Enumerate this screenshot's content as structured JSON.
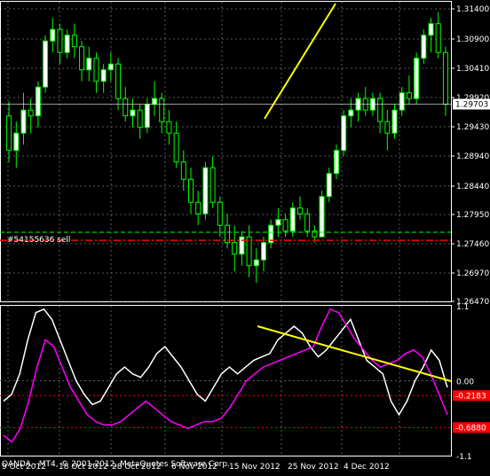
{
  "platform": {
    "copyright": "OANDA - MT4, © 2001-2012, MetaQuotes Software Corp."
  },
  "colors": {
    "background": "#000000",
    "grid": "#5a5a5a",
    "frame": "#ffffff",
    "candle_up": "#ffffff",
    "candle_down": "#00ff00",
    "trendline": "#ffff00",
    "order_line": "#00ff00",
    "stop_line": "#ff0000",
    "osc_main": "#ff00ff",
    "osc_signal": "#ffffff",
    "level_line": "#ff0000"
  },
  "order": {
    "label": "#54155636 sell"
  },
  "price_panel": {
    "current_price_label": "1.29703",
    "ticks": [
      "1.31400",
      "1.30900",
      "1.30410",
      "1.29920",
      "1.29430",
      "1.28940",
      "1.28440",
      "1.27950",
      "1.27460",
      "1.26970",
      "1.26470"
    ]
  },
  "osc_panel": {
    "ticks": [
      "1.1",
      "0.00",
      "-1.1"
    ],
    "level_labels": [
      "-0.2183",
      "-0.6880"
    ]
  },
  "time_axis": {
    "labels": [
      "9 Oct 2012",
      "18 Oct 2012",
      "28 Oct 2012",
      "6 Nov 2012",
      "15 Nov 2012",
      "25 Nov 2012",
      "4 Dec 2012"
    ]
  },
  "chart_data": [
    {
      "type": "candlestick",
      "symbol_timeframe": "",
      "ylim": [
        1.2628,
        1.3148
      ],
      "order_price": 1.2748,
      "stop_price": 1.2734,
      "current_price": 1.29703,
      "candles": [
        [
          1.295,
          1.2975,
          1.287,
          1.289
        ],
        [
          1.289,
          1.294,
          1.286,
          1.292
        ],
        [
          1.292,
          1.299,
          1.29,
          1.296
        ],
        [
          1.296,
          1.298,
          1.292,
          1.295
        ],
        [
          1.295,
          1.301,
          1.293,
          1.3
        ],
        [
          1.3,
          1.309,
          1.299,
          1.308
        ],
        [
          1.308,
          1.312,
          1.306,
          1.31
        ],
        [
          1.31,
          1.311,
          1.304,
          1.306
        ],
        [
          1.306,
          1.31,
          1.305,
          1.309
        ],
        [
          1.309,
          1.311,
          1.305,
          1.307
        ],
        [
          1.307,
          1.308,
          1.301,
          1.303
        ],
        [
          1.303,
          1.307,
          1.301,
          1.305
        ],
        [
          1.305,
          1.306,
          1.299,
          1.301
        ],
        [
          1.301,
          1.304,
          1.299,
          1.303
        ],
        [
          1.303,
          1.306,
          1.301,
          1.304
        ],
        [
          1.304,
          1.305,
          1.296,
          1.298
        ],
        [
          1.298,
          1.3,
          1.294,
          1.295
        ],
        [
          1.295,
          1.298,
          1.293,
          1.296
        ],
        [
          1.296,
          1.297,
          1.291,
          1.293
        ],
        [
          1.293,
          1.298,
          1.292,
          1.297
        ],
        [
          1.297,
          1.301,
          1.295,
          1.298
        ],
        [
          1.298,
          1.299,
          1.292,
          1.294
        ],
        [
          1.294,
          1.296,
          1.29,
          1.292
        ],
        [
          1.292,
          1.294,
          1.286,
          1.287
        ],
        [
          1.287,
          1.289,
          1.282,
          1.284
        ],
        [
          1.284,
          1.286,
          1.278,
          1.28
        ],
        [
          1.28,
          1.282,
          1.276,
          1.278
        ],
        [
          1.278,
          1.287,
          1.277,
          1.286
        ],
        [
          1.286,
          1.288,
          1.279,
          1.28
        ],
        [
          1.28,
          1.281,
          1.274,
          1.276
        ],
        [
          1.276,
          1.278,
          1.272,
          1.273
        ],
        [
          1.273,
          1.276,
          1.268,
          1.271
        ],
        [
          1.271,
          1.275,
          1.269,
          1.274
        ],
        [
          1.274,
          1.276,
          1.267,
          1.269
        ],
        [
          1.269,
          1.272,
          1.266,
          1.27
        ],
        [
          1.27,
          1.274,
          1.268,
          1.273
        ],
        [
          1.273,
          1.277,
          1.272,
          1.276
        ],
        [
          1.276,
          1.279,
          1.274,
          1.277
        ],
        [
          1.277,
          1.278,
          1.274,
          1.275
        ],
        [
          1.275,
          1.28,
          1.274,
          1.279
        ],
        [
          1.279,
          1.281,
          1.277,
          1.278
        ],
        [
          1.278,
          1.279,
          1.274,
          1.275
        ],
        [
          1.275,
          1.276,
          1.273,
          1.274
        ],
        [
          1.274,
          1.282,
          1.274,
          1.281
        ],
        [
          1.281,
          1.286,
          1.28,
          1.285
        ],
        [
          1.285,
          1.29,
          1.284,
          1.289
        ],
        [
          1.289,
          1.296,
          1.288,
          1.295
        ],
        [
          1.295,
          1.298,
          1.293,
          1.296
        ],
        [
          1.296,
          1.299,
          1.294,
          1.298
        ],
        [
          1.298,
          1.3,
          1.295,
          1.296
        ],
        [
          1.296,
          1.299,
          1.295,
          1.298
        ],
        [
          1.298,
          1.299,
          1.292,
          1.294
        ],
        [
          1.294,
          1.296,
          1.289,
          1.292
        ],
        [
          1.292,
          1.297,
          1.291,
          1.296
        ],
        [
          1.296,
          1.3,
          1.295,
          1.299
        ],
        [
          1.299,
          1.302,
          1.297,
          1.298
        ],
        [
          1.298,
          1.306,
          1.297,
          1.305
        ],
        [
          1.305,
          1.31,
          1.304,
          1.309
        ],
        [
          1.309,
          1.312,
          1.306,
          1.311
        ],
        [
          1.311,
          1.313,
          1.305,
          1.306
        ],
        [
          1.306,
          1.307,
          1.295,
          1.297
        ]
      ]
    },
    {
      "type": "line",
      "ylim": [
        -1.1,
        1.1
      ],
      "levels": [
        -0.2183,
        -0.688
      ],
      "series": [
        {
          "values": [
            -0.3,
            -0.2,
            0.1,
            0.6,
            1.0,
            1.05,
            0.9,
            0.6,
            0.3,
            0.0,
            -0.2,
            -0.35,
            -0.3,
            -0.1,
            0.1,
            0.2,
            0.1,
            0.05,
            0.2,
            0.4,
            0.5,
            0.35,
            0.2,
            0.0,
            -0.2,
            -0.3,
            -0.1,
            0.1,
            0.2,
            0.1,
            0.2,
            0.3,
            0.35,
            0.4,
            0.6,
            0.7,
            0.8,
            0.7,
            0.5,
            0.35,
            0.45,
            0.6,
            0.75,
            0.9,
            0.6,
            0.3,
            0.2,
            0.1,
            -0.3,
            -0.5,
            -0.3,
            0.0,
            0.2,
            0.45,
            0.3,
            -0.1
          ]
        },
        {
          "values": [
            -0.8,
            -0.9,
            -0.7,
            -0.3,
            0.2,
            0.6,
            0.5,
            0.2,
            -0.1,
            -0.3,
            -0.5,
            -0.6,
            -0.65,
            -0.65,
            -0.6,
            -0.5,
            -0.4,
            -0.3,
            -0.4,
            -0.5,
            -0.6,
            -0.65,
            -0.7,
            -0.65,
            -0.6,
            -0.6,
            -0.55,
            -0.4,
            -0.2,
            0.0,
            0.1,
            0.2,
            0.25,
            0.3,
            0.35,
            0.4,
            0.45,
            0.5,
            0.8,
            1.05,
            1.0,
            0.8,
            0.6,
            0.45,
            0.3,
            0.2,
            0.25,
            0.3,
            0.4,
            0.45,
            0.35,
            0.1,
            -0.2,
            -0.5
          ]
        }
      ]
    }
  ]
}
